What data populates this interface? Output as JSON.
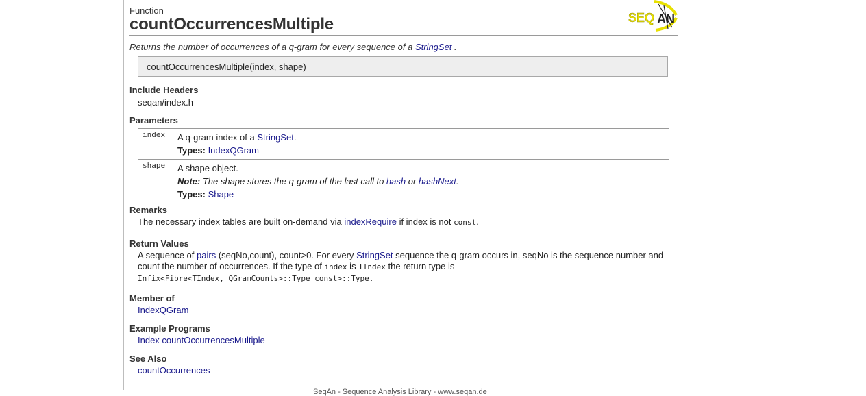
{
  "header": {
    "kind": "Function",
    "title": "countOccurrencesMultiple",
    "logo_text": "SEQAN"
  },
  "summary": {
    "text_before": "Returns the number of occurrences of a q-gram for every sequence of a ",
    "link": "StringSet",
    "text_after": " ."
  },
  "signature": "countOccurrencesMultiple(index, shape)",
  "include_headers": {
    "heading": "Include Headers",
    "value": "seqan/index.h"
  },
  "parameters": {
    "heading": "Parameters",
    "rows": [
      {
        "name": "index",
        "desc_before": "A q-gram index of a ",
        "desc_link": "StringSet",
        "desc_after": ".",
        "types_label": "Types:",
        "types_link": "IndexQGram"
      },
      {
        "name": "shape",
        "desc": "A shape object.",
        "note_label": "Note:",
        "note_before": " The shape stores the q-gram of the last call to ",
        "note_link1": "hash",
        "note_mid": " or ",
        "note_link2": "hashNext",
        "note_after": ".",
        "types_label": "Types:",
        "types_link": "Shape"
      }
    ]
  },
  "remarks": {
    "heading": "Remarks",
    "before": "The necessary index tables are built on-demand via ",
    "link": "indexRequire",
    "middle": " if index is not ",
    "code": "const",
    "after": "."
  },
  "return_values": {
    "heading": "Return Values",
    "part1": "A sequence of ",
    "link1": "pairs",
    "part2": " (seqNo,count), count>0. For every ",
    "link2": "StringSet",
    "part3": " sequence the q-gram occurs in, seqNo is the sequence number and count the number of occurrences. If the type of ",
    "code1": "index",
    "part4": " is ",
    "code2": "TIndex",
    "part5": " the return type is",
    "code3": "Infix<Fibre<TIndex, QGramCounts>::Type const>::Type."
  },
  "member_of": {
    "heading": "Member of",
    "link": "IndexQGram"
  },
  "example_programs": {
    "heading": "Example Programs",
    "link": "Index countOccurrencesMultiple"
  },
  "see_also": {
    "heading": "See Also",
    "link": "countOccurrences"
  },
  "footer": {
    "text": "SeqAn - Sequence Analysis Library - www.seqan.de"
  },
  "colors": {
    "link": "#1a1a8c",
    "logo_yellow": "#e8e000",
    "signature_bg": "#eeeeee"
  }
}
